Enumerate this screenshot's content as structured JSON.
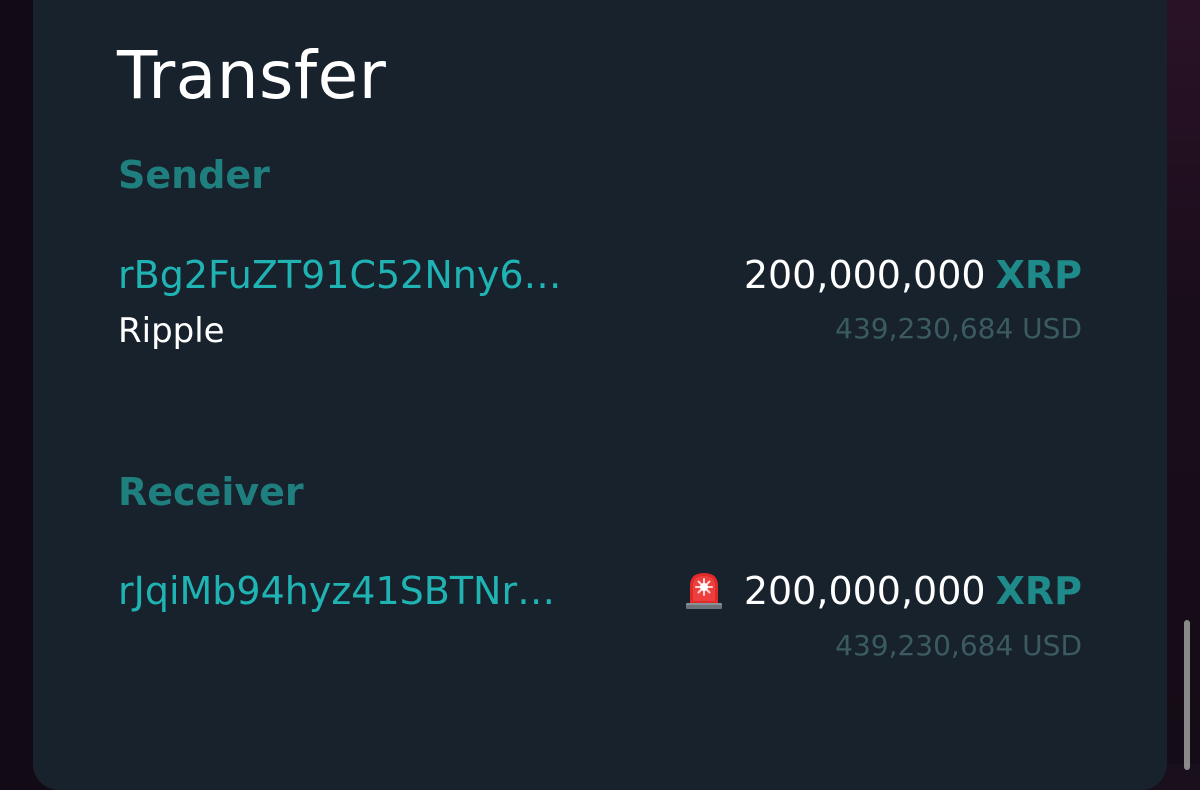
{
  "title": "Transfer",
  "sender": {
    "label": "Sender",
    "address": "rBg2FuZT91C52Nny6…",
    "entity": "Ripple",
    "amount": "200,000,000",
    "currency": "XRP",
    "usd": "439,230,684 USD"
  },
  "receiver": {
    "label": "Receiver",
    "address": "rJqiMb94hyz41SBTNr…",
    "alert_icon": "police-siren-icon",
    "amount": "200,000,000",
    "currency": "XRP",
    "usd": "439,230,684 USD"
  },
  "colors": {
    "card_bg": "#18222c",
    "section_label": "#1f7f7f",
    "address": "#1fb3b3",
    "currency": "#1f8a8a",
    "usd": "#3b5b60",
    "alert": "#e02b2b"
  }
}
